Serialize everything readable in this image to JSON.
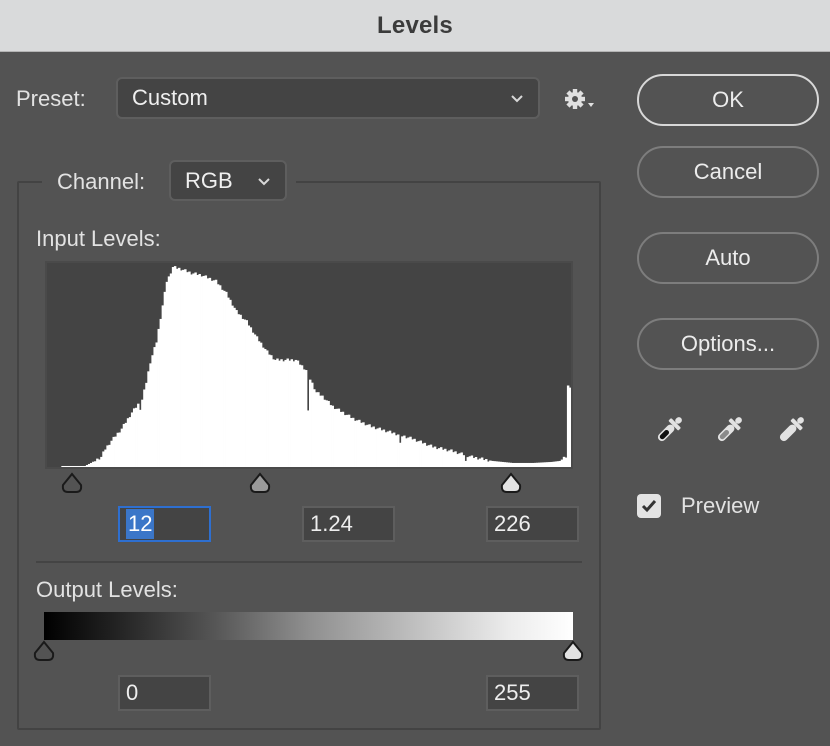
{
  "dialog": {
    "title": "Levels"
  },
  "preset": {
    "label": "Preset:",
    "value": "Custom",
    "icons": {
      "dropdown": "chevron-down-icon",
      "settings": "gear-menu-icon"
    }
  },
  "channel": {
    "label": "Channel:",
    "value": "RGB"
  },
  "input_levels": {
    "label": "Input Levels:",
    "black": "12",
    "gamma": "1.24",
    "white": "226",
    "black_point": 12,
    "gamma_value": 1.24,
    "white_point": 226,
    "focused_field": "black"
  },
  "output_levels": {
    "label": "Output Levels:",
    "black": "0",
    "white": "255",
    "black_point": 0,
    "white_point": 255
  },
  "buttons": {
    "ok": "OK",
    "cancel": "Cancel",
    "auto": "Auto",
    "options": "Options..."
  },
  "eyedroppers": [
    {
      "name": "black-point-eyedropper-icon",
      "tone": "black"
    },
    {
      "name": "gray-point-eyedropper-icon",
      "tone": "gray"
    },
    {
      "name": "white-point-eyedropper-icon",
      "tone": "white"
    }
  ],
  "preview": {
    "label": "Preview",
    "checked": true
  },
  "colors": {
    "dialog_bg": "#535353",
    "titlebar_bg": "#d9dadb",
    "field_bg": "#444444",
    "focus_blue": "#2e6fd0",
    "histogram_fill": "#ffffff",
    "histogram_bg": "#444444"
  },
  "histogram": {
    "range": [
      0,
      255
    ],
    "units": "percent of peak",
    "profile": [
      [
        0,
        0
      ],
      [
        6,
        0
      ],
      [
        7,
        0.5
      ],
      [
        18,
        0.5
      ],
      [
        21,
        2
      ],
      [
        26,
        5
      ],
      [
        28,
        9
      ],
      [
        31,
        13
      ],
      [
        36,
        19
      ],
      [
        41,
        27
      ],
      [
        44,
        31
      ],
      [
        45,
        29
      ],
      [
        48,
        42
      ],
      [
        50,
        52
      ],
      [
        53,
        62
      ],
      [
        55,
        74
      ],
      [
        58,
        92
      ],
      [
        59,
        94
      ],
      [
        61,
        99
      ],
      [
        65,
        98
      ],
      [
        70,
        96
      ],
      [
        75,
        95
      ],
      [
        82,
        92
      ],
      [
        87,
        86
      ],
      [
        92,
        77
      ],
      [
        97,
        72
      ],
      [
        102,
        64
      ],
      [
        107,
        57
      ],
      [
        111,
        53
      ],
      [
        116,
        53
      ],
      [
        121,
        53
      ],
      [
        126,
        48
      ],
      [
        131,
        37
      ],
      [
        134,
        35
      ],
      [
        139,
        30
      ],
      [
        149,
        24
      ],
      [
        158,
        20
      ],
      [
        168,
        17
      ],
      [
        178,
        14
      ],
      [
        188,
        10
      ],
      [
        197,
        8
      ],
      [
        207,
        5
      ],
      [
        217,
        3
      ],
      [
        227,
        2
      ],
      [
        237,
        2
      ],
      [
        246,
        2.5
      ],
      [
        250,
        3
      ],
      [
        253,
        5
      ],
      [
        254,
        40
      ],
      [
        255,
        40
      ]
    ],
    "dips": [
      [
        127,
        28
      ],
      [
        172,
        12
      ],
      [
        204,
        3
      ]
    ]
  }
}
